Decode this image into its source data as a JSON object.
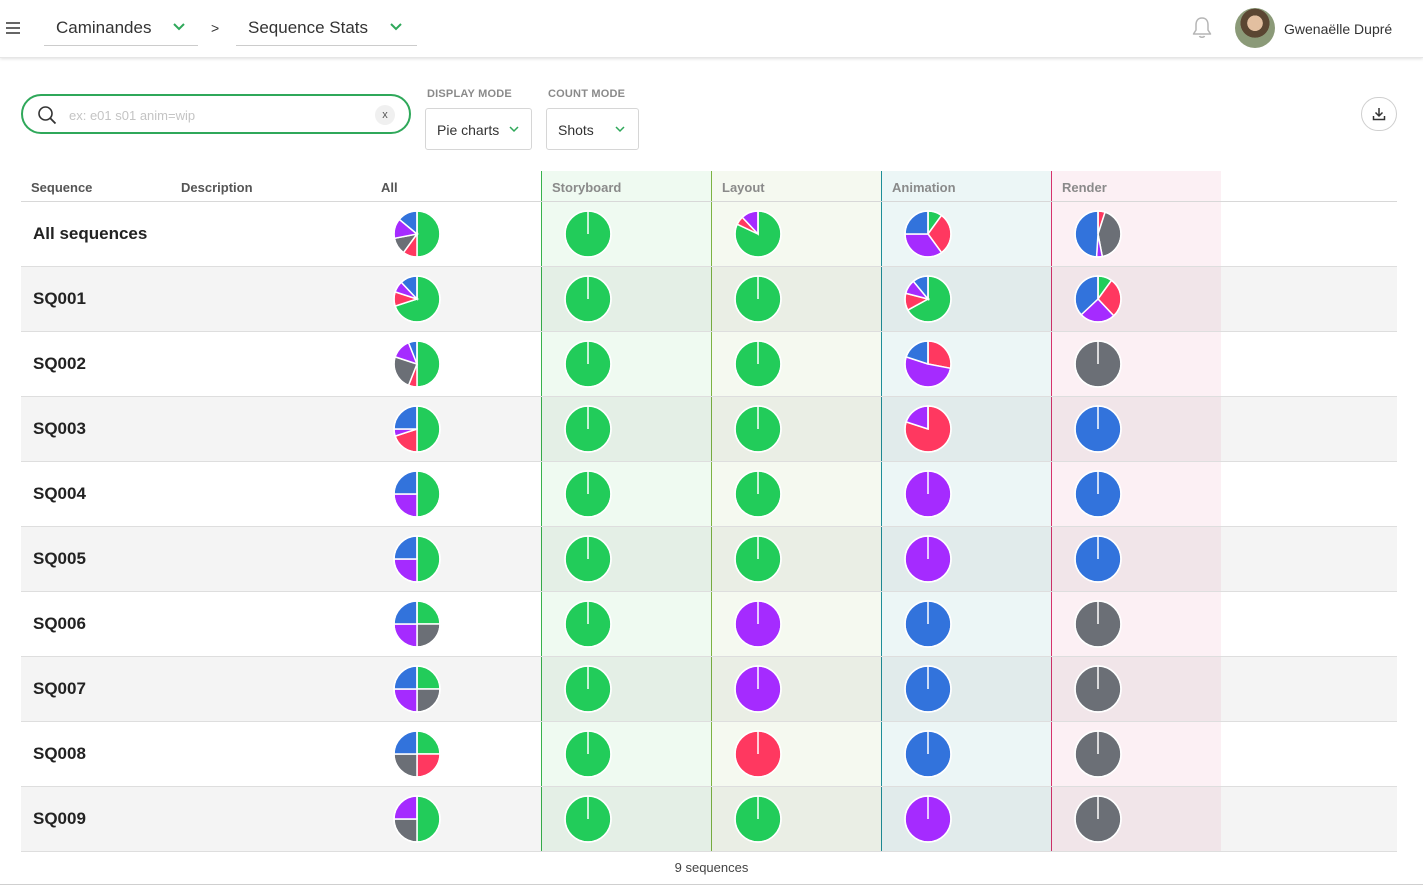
{
  "header": {
    "production": "Caminandes",
    "separator": ">",
    "section": "Sequence Stats",
    "user_name": "Gwenaëlle Dupré"
  },
  "filters": {
    "search_placeholder": "ex: e01 s01 anim=wip",
    "clear_label": "x",
    "display_mode_label": "DISPLAY MODE",
    "display_mode_value": "Pie charts",
    "count_mode_label": "COUNT MODE",
    "count_mode_value": "Shots"
  },
  "colors": {
    "green": "#22cc5a",
    "purple": "#a52bff",
    "blue": "#3273dc",
    "red": "#ff3860",
    "gray": "#6b6f76",
    "accent": "#2fa85a"
  },
  "table": {
    "columns": {
      "sequence": "Sequence",
      "description": "Description",
      "all": "All",
      "storyboard": "Storyboard",
      "layout": "Layout",
      "animation": "Animation",
      "render": "Render"
    },
    "rows": [
      {
        "name": "All sequences",
        "all": [
          [
            "green",
            0.5
          ],
          [
            "red",
            0.1
          ],
          [
            "gray",
            0.12
          ],
          [
            "purple",
            0.14
          ],
          [
            "blue",
            0.14
          ]
        ],
        "storyboard": [
          [
            "green",
            1
          ]
        ],
        "layout": [
          [
            "green",
            0.82
          ],
          [
            "red",
            0.06
          ],
          [
            "purple",
            0.12
          ]
        ],
        "animation": [
          [
            "green",
            0.1
          ],
          [
            "red",
            0.3
          ],
          [
            "purple",
            0.35
          ],
          [
            "blue",
            0.25
          ]
        ],
        "render": [
          [
            "red",
            0.05
          ],
          [
            "gray",
            0.42
          ],
          [
            "purple",
            0.04
          ],
          [
            "blue",
            0.49
          ]
        ]
      },
      {
        "name": "SQ001",
        "all": [
          [
            "green",
            0.7
          ],
          [
            "red",
            0.1
          ],
          [
            "purple",
            0.08
          ],
          [
            "blue",
            0.12
          ]
        ],
        "storyboard": [
          [
            "green",
            1
          ]
        ],
        "layout": [
          [
            "green",
            1
          ]
        ],
        "animation": [
          [
            "green",
            0.67
          ],
          [
            "red",
            0.12
          ],
          [
            "purple",
            0.1
          ],
          [
            "blue",
            0.11
          ]
        ],
        "render": [
          [
            "green",
            0.1
          ],
          [
            "red",
            0.28
          ],
          [
            "purple",
            0.25
          ],
          [
            "blue",
            0.37
          ]
        ]
      },
      {
        "name": "SQ002",
        "all": [
          [
            "green",
            0.5
          ],
          [
            "red",
            0.06
          ],
          [
            "gray",
            0.24
          ],
          [
            "purple",
            0.14
          ],
          [
            "blue",
            0.06
          ]
        ],
        "storyboard": [
          [
            "green",
            1
          ]
        ],
        "layout": [
          [
            "green",
            1
          ]
        ],
        "animation": [
          [
            "red",
            0.28
          ],
          [
            "purple",
            0.52
          ],
          [
            "blue",
            0.2
          ]
        ],
        "render": [
          [
            "gray",
            1
          ]
        ]
      },
      {
        "name": "SQ003",
        "all": [
          [
            "green",
            0.5
          ],
          [
            "red",
            0.2
          ],
          [
            "purple",
            0.05
          ],
          [
            "blue",
            0.25
          ]
        ],
        "storyboard": [
          [
            "green",
            1
          ]
        ],
        "layout": [
          [
            "green",
            1
          ]
        ],
        "animation": [
          [
            "red",
            0.8
          ],
          [
            "purple",
            0.2
          ]
        ],
        "render": [
          [
            "blue",
            1
          ]
        ]
      },
      {
        "name": "SQ004",
        "all": [
          [
            "green",
            0.5
          ],
          [
            "purple",
            0.25
          ],
          [
            "blue",
            0.25
          ]
        ],
        "storyboard": [
          [
            "green",
            1
          ]
        ],
        "layout": [
          [
            "green",
            1
          ]
        ],
        "animation": [
          [
            "purple",
            1
          ]
        ],
        "render": [
          [
            "blue",
            1
          ]
        ]
      },
      {
        "name": "SQ005",
        "all": [
          [
            "green",
            0.5
          ],
          [
            "purple",
            0.25
          ],
          [
            "blue",
            0.25
          ]
        ],
        "storyboard": [
          [
            "green",
            1
          ]
        ],
        "layout": [
          [
            "green",
            1
          ]
        ],
        "animation": [
          [
            "purple",
            1
          ]
        ],
        "render": [
          [
            "blue",
            1
          ]
        ]
      },
      {
        "name": "SQ006",
        "all": [
          [
            "green",
            0.25
          ],
          [
            "gray",
            0.25
          ],
          [
            "purple",
            0.25
          ],
          [
            "blue",
            0.25
          ]
        ],
        "storyboard": [
          [
            "green",
            1
          ]
        ],
        "layout": [
          [
            "purple",
            1
          ]
        ],
        "animation": [
          [
            "blue",
            1
          ]
        ],
        "render": [
          [
            "gray",
            1
          ]
        ]
      },
      {
        "name": "SQ007",
        "all": [
          [
            "green",
            0.25
          ],
          [
            "gray",
            0.25
          ],
          [
            "purple",
            0.25
          ],
          [
            "blue",
            0.25
          ]
        ],
        "storyboard": [
          [
            "green",
            1
          ]
        ],
        "layout": [
          [
            "purple",
            1
          ]
        ],
        "animation": [
          [
            "blue",
            1
          ]
        ],
        "render": [
          [
            "gray",
            1
          ]
        ]
      },
      {
        "name": "SQ008",
        "all": [
          [
            "green",
            0.25
          ],
          [
            "red",
            0.25
          ],
          [
            "gray",
            0.25
          ],
          [
            "blue",
            0.25
          ]
        ],
        "storyboard": [
          [
            "green",
            1
          ]
        ],
        "layout": [
          [
            "red",
            1
          ]
        ],
        "animation": [
          [
            "blue",
            1
          ]
        ],
        "render": [
          [
            "gray",
            1
          ]
        ]
      },
      {
        "name": "SQ009",
        "all": [
          [
            "green",
            0.5
          ],
          [
            "gray",
            0.25
          ],
          [
            "purple",
            0.25
          ]
        ],
        "storyboard": [
          [
            "green",
            1
          ]
        ],
        "layout": [
          [
            "green",
            1
          ]
        ],
        "animation": [
          [
            "purple",
            1
          ]
        ],
        "render": [
          [
            "gray",
            1
          ]
        ]
      }
    ],
    "footer": "9 sequences"
  },
  "icons": [
    "menu-icon",
    "chevron-down-icon",
    "bell-icon",
    "search-icon",
    "download-icon"
  ]
}
